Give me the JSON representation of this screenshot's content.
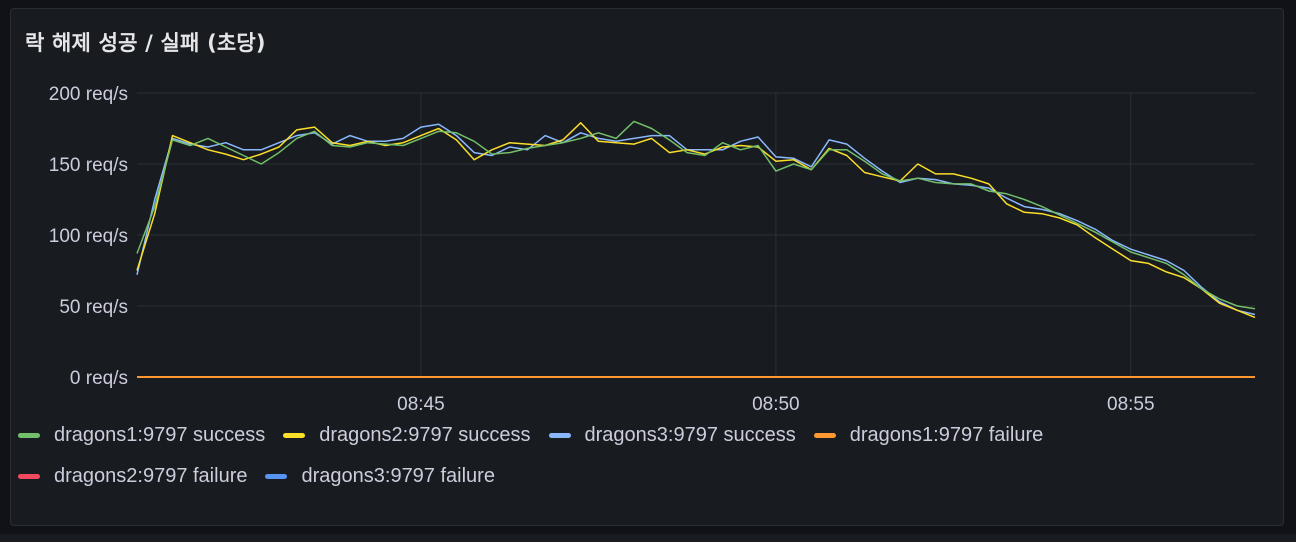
{
  "panel": {
    "title": "락 해제 성공 / 실패 (초당)"
  },
  "chart_data": {
    "type": "line",
    "title": "락 해제 성공 / 실패 (초당)",
    "xlabel": "",
    "ylabel": "",
    "x_range": [
      "08:41",
      "08:57"
    ],
    "x_ticks": [
      "08:45",
      "08:50",
      "08:55"
    ],
    "y_ticks": [
      "0 req/s",
      "50 req/s",
      "100 req/s",
      "150 req/s",
      "200 req/s"
    ],
    "ylim": [
      0,
      200
    ],
    "unit": "req/s",
    "grid": true,
    "legend_position": "bottom",
    "series": [
      {
        "name": "dragons1:9797 success",
        "color": "#73bf69",
        "points": [
          [
            0,
            87
          ],
          [
            0.25,
            120
          ],
          [
            0.5,
            167
          ],
          [
            0.75,
            163
          ],
          [
            1,
            168
          ],
          [
            1.25,
            162
          ],
          [
            1.5,
            156
          ],
          [
            1.75,
            150
          ],
          [
            2,
            158
          ],
          [
            2.25,
            168
          ],
          [
            2.5,
            173
          ],
          [
            2.75,
            163
          ],
          [
            3,
            162
          ],
          [
            3.25,
            165
          ],
          [
            3.5,
            164
          ],
          [
            3.75,
            163
          ],
          [
            4,
            168
          ],
          [
            4.25,
            173
          ],
          [
            4.5,
            172
          ],
          [
            4.75,
            166
          ],
          [
            5,
            157
          ],
          [
            5.25,
            158
          ],
          [
            5.5,
            161
          ],
          [
            5.75,
            163
          ],
          [
            6,
            165
          ],
          [
            6.25,
            168
          ],
          [
            6.5,
            172
          ],
          [
            6.75,
            168
          ],
          [
            7,
            180
          ],
          [
            7.25,
            175
          ],
          [
            7.5,
            167
          ],
          [
            7.75,
            158
          ],
          [
            8,
            156
          ],
          [
            8.25,
            165
          ],
          [
            8.5,
            160
          ],
          [
            8.75,
            163
          ],
          [
            9,
            145
          ],
          [
            9.25,
            150
          ],
          [
            9.5,
            146
          ],
          [
            9.75,
            160
          ],
          [
            10,
            160
          ],
          [
            10.25,
            152
          ],
          [
            10.5,
            143
          ],
          [
            10.75,
            138
          ],
          [
            11,
            140
          ],
          [
            11.25,
            137
          ],
          [
            11.5,
            136
          ],
          [
            11.75,
            136
          ],
          [
            12,
            131
          ],
          [
            12.25,
            129
          ],
          [
            12.5,
            125
          ],
          [
            12.75,
            120
          ],
          [
            13,
            114
          ],
          [
            13.25,
            108
          ],
          [
            13.5,
            102
          ],
          [
            13.75,
            95
          ],
          [
            14,
            88
          ],
          [
            14.25,
            84
          ],
          [
            14.5,
            80
          ],
          [
            14.75,
            72
          ],
          [
            15,
            62
          ],
          [
            15.25,
            55
          ],
          [
            15.5,
            50
          ],
          [
            15.75,
            48
          ]
        ]
      },
      {
        "name": "dragons2:9797 success",
        "color": "#fade2a",
        "points": [
          [
            0,
            75
          ],
          [
            0.25,
            115
          ],
          [
            0.5,
            170
          ],
          [
            0.75,
            165
          ],
          [
            1,
            160
          ],
          [
            1.25,
            157
          ],
          [
            1.5,
            153
          ],
          [
            1.75,
            157
          ],
          [
            2,
            162
          ],
          [
            2.25,
            174
          ],
          [
            2.5,
            176
          ],
          [
            2.75,
            165
          ],
          [
            3,
            163
          ],
          [
            3.25,
            166
          ],
          [
            3.5,
            163
          ],
          [
            3.75,
            165
          ],
          [
            4,
            170
          ],
          [
            4.25,
            175
          ],
          [
            4.5,
            167
          ],
          [
            4.75,
            153
          ],
          [
            5,
            160
          ],
          [
            5.25,
            165
          ],
          [
            5.5,
            164
          ],
          [
            5.75,
            163
          ],
          [
            6,
            167
          ],
          [
            6.25,
            179
          ],
          [
            6.5,
            166
          ],
          [
            6.75,
            165
          ],
          [
            7,
            164
          ],
          [
            7.25,
            168
          ],
          [
            7.5,
            158
          ],
          [
            7.75,
            160
          ],
          [
            8,
            157
          ],
          [
            8.25,
            162
          ],
          [
            8.5,
            163
          ],
          [
            8.75,
            162
          ],
          [
            9,
            152
          ],
          [
            9.25,
            153
          ],
          [
            9.5,
            146
          ],
          [
            9.75,
            161
          ],
          [
            10,
            156
          ],
          [
            10.25,
            144
          ],
          [
            10.5,
            141
          ],
          [
            10.75,
            138
          ],
          [
            11,
            150
          ],
          [
            11.25,
            143
          ],
          [
            11.5,
            143
          ],
          [
            11.75,
            140
          ],
          [
            12,
            136
          ],
          [
            12.25,
            122
          ],
          [
            12.5,
            116
          ],
          [
            12.75,
            115
          ],
          [
            13,
            112
          ],
          [
            13.25,
            107
          ],
          [
            13.5,
            98
          ],
          [
            13.75,
            90
          ],
          [
            14,
            82
          ],
          [
            14.25,
            80
          ],
          [
            14.5,
            74
          ],
          [
            14.75,
            70
          ],
          [
            15,
            62
          ],
          [
            15.25,
            52
          ],
          [
            15.5,
            47
          ],
          [
            15.75,
            42
          ]
        ]
      },
      {
        "name": "dragons3:9797 success",
        "color": "#8ab8ff",
        "points": [
          [
            0,
            72
          ],
          [
            0.25,
            125
          ],
          [
            0.5,
            168
          ],
          [
            0.75,
            164
          ],
          [
            1,
            162
          ],
          [
            1.25,
            165
          ],
          [
            1.5,
            160
          ],
          [
            1.75,
            160
          ],
          [
            2,
            165
          ],
          [
            2.25,
            170
          ],
          [
            2.5,
            172
          ],
          [
            2.75,
            164
          ],
          [
            3,
            170
          ],
          [
            3.25,
            166
          ],
          [
            3.5,
            166
          ],
          [
            3.75,
            168
          ],
          [
            4,
            176
          ],
          [
            4.25,
            178
          ],
          [
            4.5,
            170
          ],
          [
            4.75,
            158
          ],
          [
            5,
            156
          ],
          [
            5.25,
            162
          ],
          [
            5.5,
            160
          ],
          [
            5.75,
            170
          ],
          [
            6,
            165
          ],
          [
            6.25,
            172
          ],
          [
            6.5,
            168
          ],
          [
            6.75,
            166
          ],
          [
            7,
            168
          ],
          [
            7.25,
            170
          ],
          [
            7.5,
            170
          ],
          [
            7.75,
            160
          ],
          [
            8,
            160
          ],
          [
            8.25,
            160
          ],
          [
            8.5,
            166
          ],
          [
            8.75,
            169
          ],
          [
            9,
            155
          ],
          [
            9.25,
            154
          ],
          [
            9.5,
            148
          ],
          [
            9.75,
            167
          ],
          [
            10,
            164
          ],
          [
            10.25,
            154
          ],
          [
            10.5,
            145
          ],
          [
            10.75,
            137
          ],
          [
            11,
            140
          ],
          [
            11.25,
            139
          ],
          [
            11.5,
            136
          ],
          [
            11.75,
            135
          ],
          [
            12,
            133
          ],
          [
            12.25,
            126
          ],
          [
            12.5,
            120
          ],
          [
            12.75,
            118
          ],
          [
            13,
            115
          ],
          [
            13.25,
            110
          ],
          [
            13.5,
            104
          ],
          [
            13.75,
            96
          ],
          [
            14,
            90
          ],
          [
            14.25,
            86
          ],
          [
            14.5,
            82
          ],
          [
            14.75,
            75
          ],
          [
            15,
            63
          ],
          [
            15.25,
            53
          ],
          [
            15.5,
            47
          ],
          [
            15.75,
            44
          ]
        ]
      },
      {
        "name": "dragons1:9797 failure",
        "color": "#ff9830",
        "points": [
          [
            0,
            0
          ],
          [
            15.75,
            0
          ]
        ]
      },
      {
        "name": "dragons2:9797 failure",
        "color": "#f2495c",
        "points": [
          [
            0,
            0
          ],
          [
            15.75,
            0
          ]
        ]
      },
      {
        "name": "dragons3:9797 failure",
        "color": "#5794f2",
        "points": [
          [
            0,
            0
          ],
          [
            15.75,
            0
          ]
        ]
      }
    ]
  }
}
